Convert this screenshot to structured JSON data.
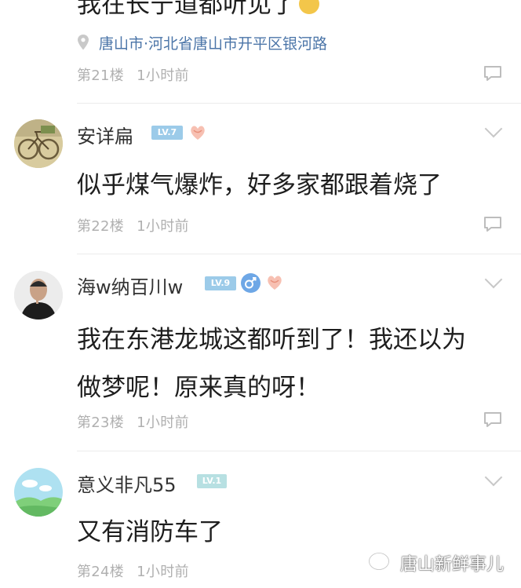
{
  "comments": [
    {
      "content": "我在长宁道都听见了",
      "location": "唐山市·河北省唐山市开平区银河路",
      "floor": "第21楼",
      "time": "1小时前"
    },
    {
      "username": "安详扁",
      "level": "LV.7",
      "content": "似乎煤气爆炸，好多家都跟着烧了",
      "floor": "第22楼",
      "time": "1小时前"
    },
    {
      "username": "海w纳百川w",
      "level": "LV.9",
      "content_line1": "我在东港龙城这都听到了！我还以为",
      "content_line2": "做梦呢！原来真的呀！",
      "floor": "第23楼",
      "time": "1小时前"
    },
    {
      "username": "意义非凡55",
      "level": "LV.1",
      "content": "又有消防车了",
      "floor": "第24楼",
      "time": "1小时前"
    }
  ],
  "watermark": {
    "text": "唐山新鲜事儿",
    "icon": "wechat-icon"
  },
  "icons": {
    "location": "location-pin-icon",
    "reply": "comment-reply-icon",
    "more": "chevron-down-icon",
    "badge": "heart-hands-badge-icon",
    "gender": "male-gender-icon"
  },
  "colors": {
    "level_badge": "#9ccbe9",
    "level_badge_low": "#b7e0e2",
    "location_text": "#4b75a8",
    "meta_text": "#b0b0b0",
    "male_badge": "#6ea7e6"
  }
}
